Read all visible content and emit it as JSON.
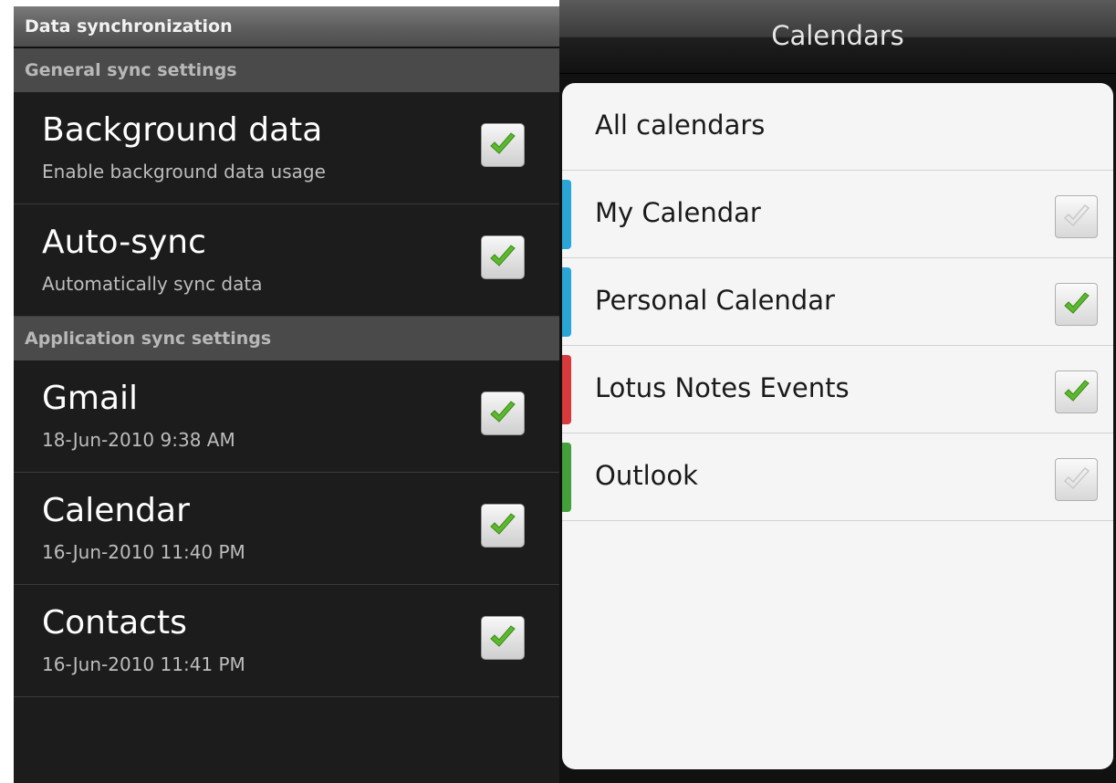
{
  "left_panel": {
    "title": "Data synchronization",
    "general_section": "General sync settings",
    "general_items": [
      {
        "title": "Background data",
        "summary": "Enable background data usage",
        "checked": true
      },
      {
        "title": "Auto-sync",
        "summary": "Automatically sync data",
        "checked": true
      }
    ],
    "app_section": "Application sync settings",
    "app_items": [
      {
        "title": "Gmail",
        "summary": "18-Jun-2010 9:38 AM",
        "checked": true
      },
      {
        "title": "Calendar",
        "summary": "16-Jun-2010 11:40 PM",
        "checked": true
      },
      {
        "title": "Contacts",
        "summary": "16-Jun-2010 11:41 PM",
        "checked": true
      }
    ]
  },
  "right_panel": {
    "title": "Calendars",
    "all_calendars": "All calendars",
    "calendars": [
      {
        "label": "My Calendar",
        "color": "#2aa6d6",
        "checked": false
      },
      {
        "label": "Personal Calendar",
        "color": "#2aa6d6",
        "checked": true
      },
      {
        "label": "Lotus Notes Events",
        "color": "#d63a3a",
        "checked": true
      },
      {
        "label": "Outlook",
        "color": "#43a03a",
        "checked": false
      }
    ]
  },
  "icons": {
    "checked": "checkmark-icon",
    "unchecked": "checkmark-outline-icon"
  },
  "colors": {
    "check_green": "#5cb82e",
    "check_grey": "#c9c9c9"
  }
}
